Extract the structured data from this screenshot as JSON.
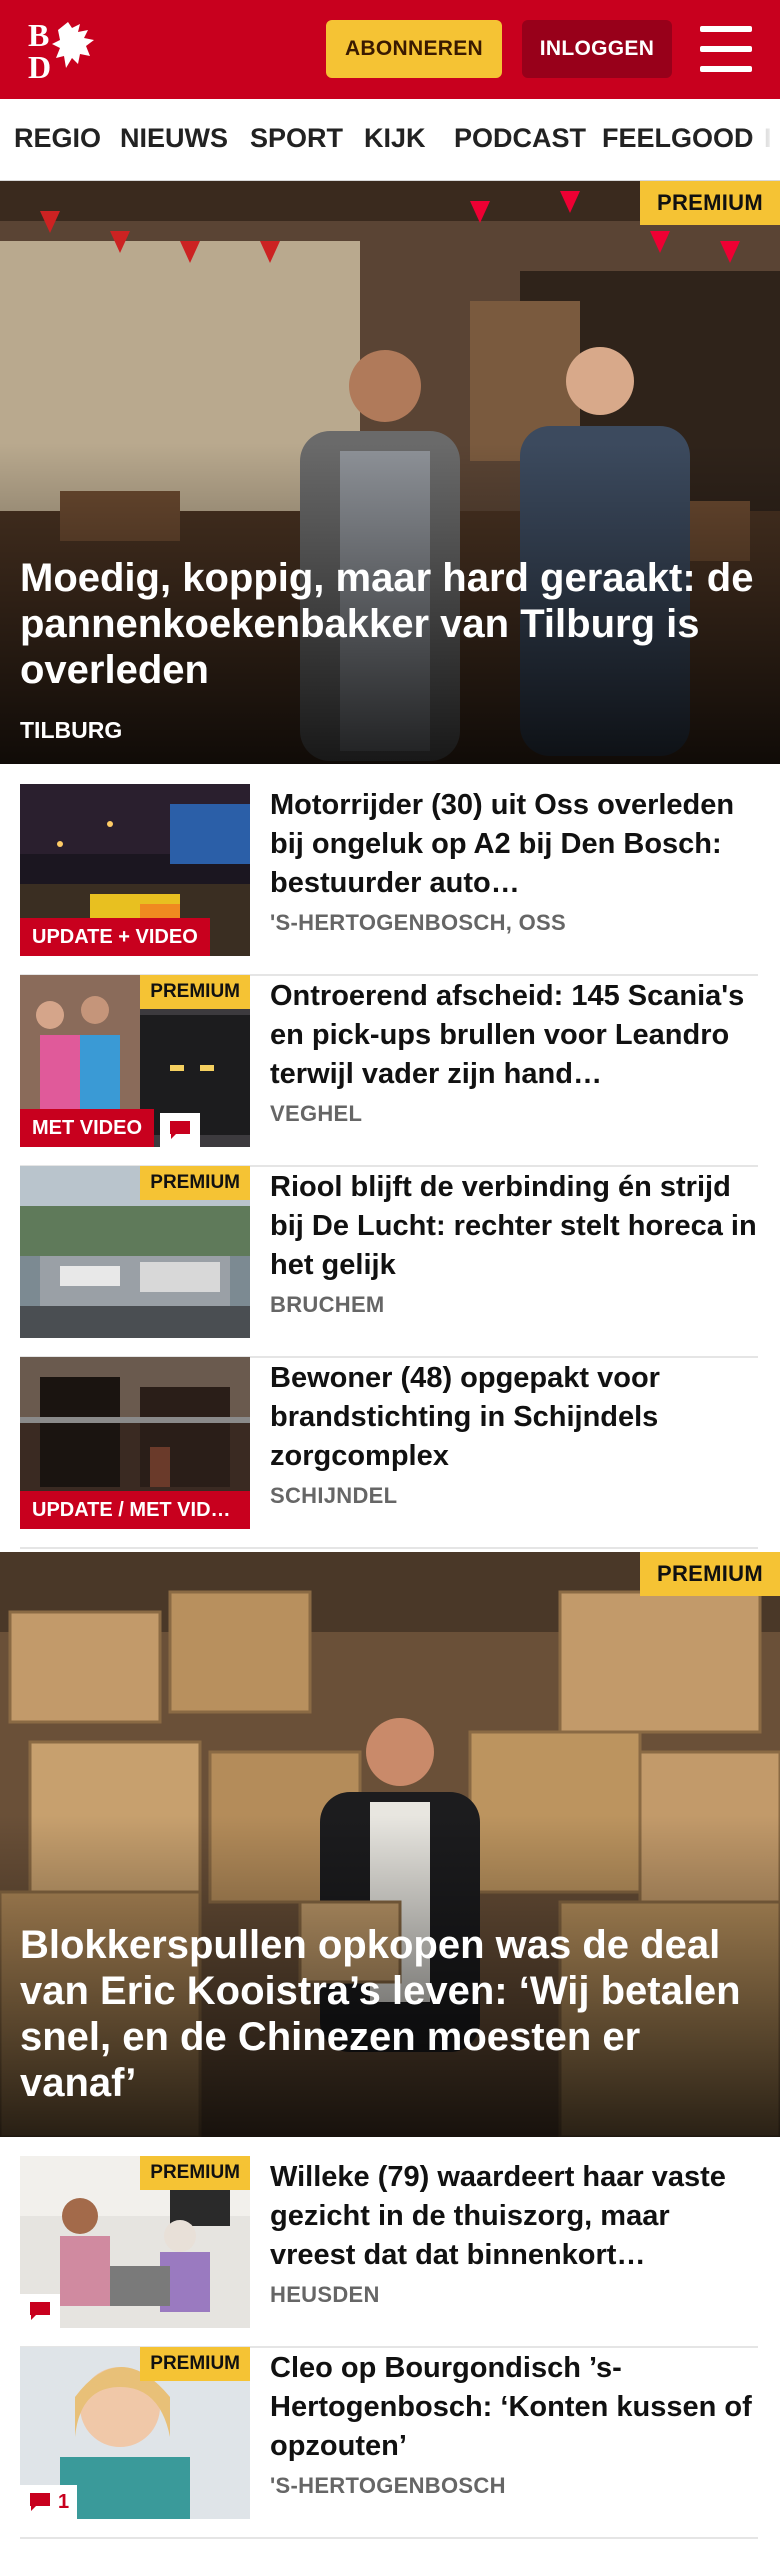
{
  "header": {
    "logo_text": "BD",
    "subscribe_label": "ABONNEREN",
    "login_label": "INLOGGEN",
    "menu_icon": "hamburger-menu-icon",
    "brand_color": "#c8001e",
    "accent_color": "#f5c334"
  },
  "nav": {
    "items": [
      {
        "label": "REGIO"
      },
      {
        "label": "NIEUWS"
      },
      {
        "label": "SPORT"
      },
      {
        "label": "KIJK"
      },
      {
        "label": "PODCAST"
      },
      {
        "label": "FEELGOOD"
      }
    ]
  },
  "hero1": {
    "badge": "PREMIUM",
    "title": "Moedig, koppig, maar hard geraakt: de pannenkoekenbakker van Tilburg is overleden",
    "location": "TILBURG"
  },
  "articles1": [
    {
      "title": "Motorrijder (30) uit Oss overleden bij ongeluk op A2 bij Den Bosch: bestuurder auto…",
      "location": "'S-HERTOGENBOSCH, OSS",
      "label": "UPDATE + VIDEO"
    },
    {
      "title": "Ontroerend afscheid: 145 Scania's en pick-ups brullen voor Leandro terwijl vader zijn hand…",
      "location": "VEGHEL",
      "label": "MET VIDEO",
      "badge": "PREMIUM",
      "comment_icon": "comment-icon"
    },
    {
      "title": "Riool blijft de verbinding én strijd bij De Lucht: rechter stelt horeca in het gelijk",
      "location": "BRUCHEM",
      "badge": "PREMIUM"
    },
    {
      "title": "Bewoner (48) opgepakt voor brandstichting in Schijndels zorgcomplex",
      "location": "SCHIJNDEL",
      "label": "UPDATE / MET VID…"
    }
  ],
  "hero2": {
    "badge": "PREMIUM",
    "title": "Blokkerspullen opkopen was de deal van Eric Kooistra’s leven: ‘Wij betalen snel, en de Chinezen moesten er vanaf’"
  },
  "articles2": [
    {
      "title": "Willeke (79) waardeert haar vaste gezicht in de thuiszorg, maar vreest dat dat binnenkort…",
      "location": "HEUSDEN",
      "badge": "PREMIUM",
      "comment_icon": "comment-icon"
    },
    {
      "title": "Cleo op Bourgondisch ’s-Hertogenbosch: ‘Konten kussen of opzouten’",
      "location": "'S-HERTOGENBOSCH",
      "badge": "PREMIUM",
      "comment_icon": "comment-icon",
      "comment_count": "1"
    }
  ]
}
